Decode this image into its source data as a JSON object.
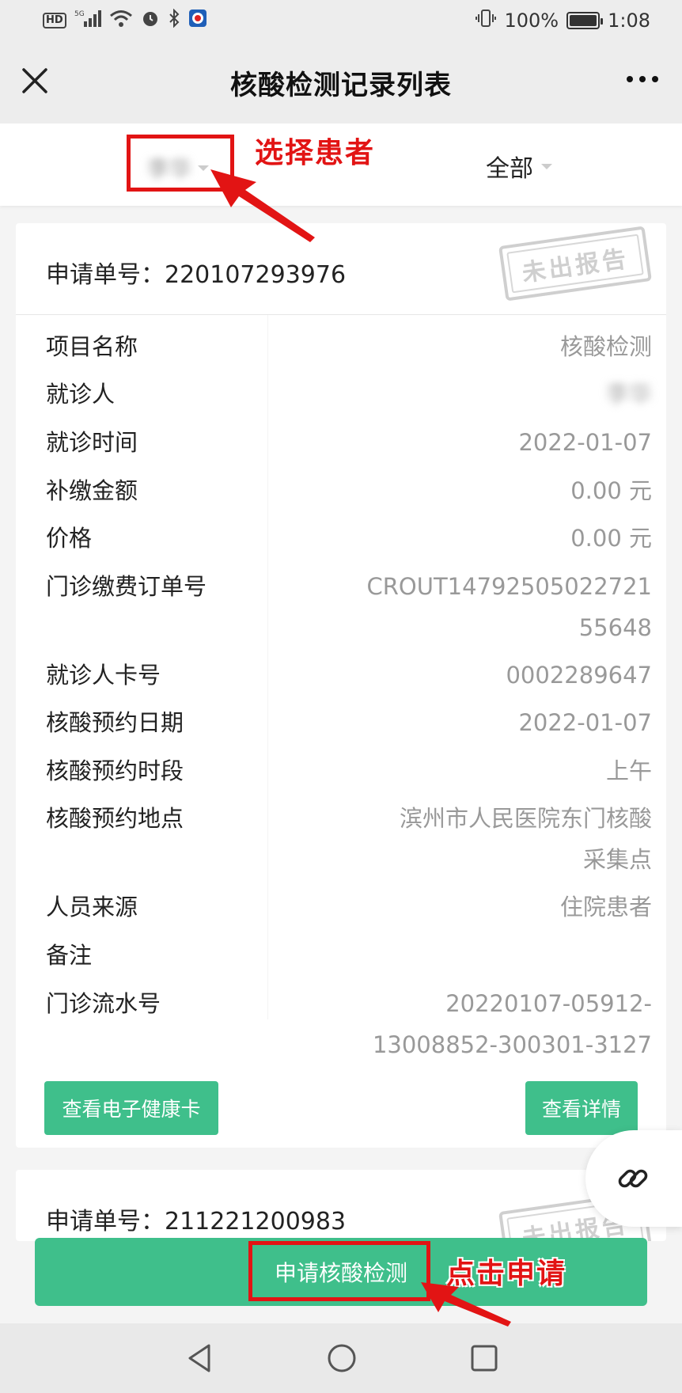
{
  "status_bar": {
    "signal_label": "5G",
    "battery_percent": "100%",
    "battery_level": 1.0,
    "time": "1:08"
  },
  "nav": {
    "title": "核酸检测记录列表"
  },
  "filter": {
    "patient_name": "李华",
    "status_filter": "全部"
  },
  "card": {
    "request_label": "申请单号：",
    "request_no": "220107293976",
    "stamp": "未出报告",
    "rows": [
      {
        "label": "项目名称",
        "value": "核酸检测"
      },
      {
        "label": "就诊人",
        "value": "李华"
      },
      {
        "label": "就诊时间",
        "value": "2022-01-07"
      },
      {
        "label": "补缴金额",
        "value": "0.00 元"
      },
      {
        "label": "价格",
        "value": "0.00 元"
      },
      {
        "label": "门诊缴费订单号",
        "value_lines": [
          "CROUT14792505022721",
          "55648"
        ]
      },
      {
        "label": "就诊人卡号",
        "value": "0002289647"
      },
      {
        "label": "核酸预约日期",
        "value": "2022-01-07"
      },
      {
        "label": "核酸预约时段",
        "value": "上午"
      },
      {
        "label": "核酸预约地点",
        "value_lines": [
          "滨州市人民医院东门核酸",
          "采集点"
        ]
      },
      {
        "label": "人员来源",
        "value": "住院患者"
      },
      {
        "label": "备注",
        "value": ""
      },
      {
        "label": "门诊流水号",
        "value_lines": [
          "20220107-05912-",
          "13008852-300301-3127"
        ]
      }
    ],
    "btn_health_card": "查看电子健康卡",
    "btn_details": "查看详情"
  },
  "card2": {
    "request_label": "申请单号：",
    "request_no": "211221200983",
    "stamp": "未出报告"
  },
  "apply": {
    "label": "申请核酸检测"
  },
  "annotations": {
    "select_patient": "选择患者",
    "click_apply": "点击申请",
    "color": "#e21414"
  },
  "colors": {
    "accent_green": "#3fbf8b"
  }
}
